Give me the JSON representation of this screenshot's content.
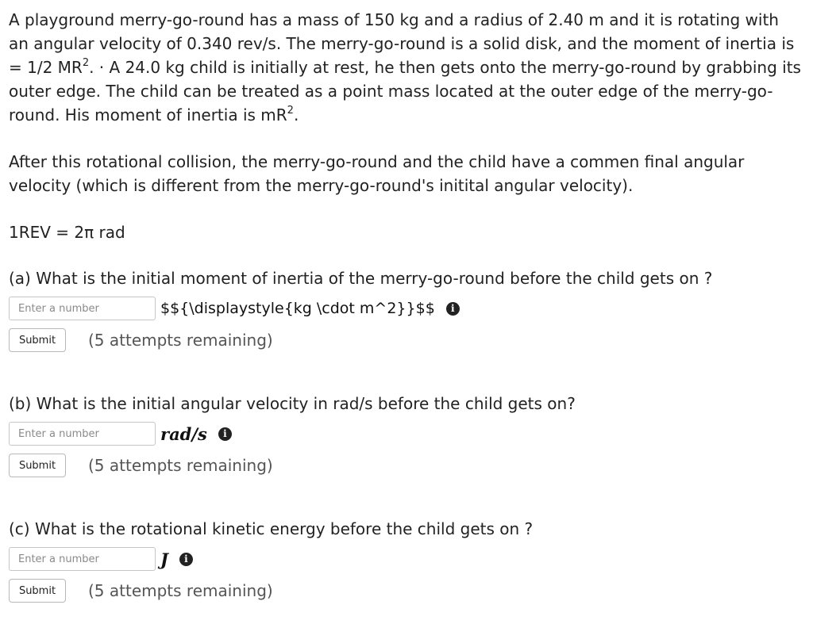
{
  "problem": {
    "p1_a": "A playground merry-go-round has a mass of 150 kg and a radius of 2.40 m and it is rotating with an angular velocity of 0.340 rev/s.   The merry-go-round is a solid disk, and the moment of inertia is = 1/2 MR",
    "p1_sup1": "2",
    "p1_b": ". · A 24.0 kg child is initially at rest, he then gets onto the merry-go-round by grabbing its outer edge. The child can be treated as a point mass located at the outer edge of the merry-go-round. His moment  of inertia is mR",
    "p1_sup2": "2",
    "p1_c": ".",
    "p2": "After this rotational collision, the merry-go-round and the child have a commen final angular velocity (which is different from the merry-go-round's initital angular velocity).",
    "p3": "1REV = 2π  rad"
  },
  "questions": [
    {
      "text": "(a) What is the initial moment of inertia of the merry-go-round before the child gets on ?",
      "placeholder": "Enter a number",
      "value": "",
      "unit": "$${\\displaystyle{kg \\cdot m^2}}$$",
      "info": "i",
      "submit": "Submit",
      "attempts": "(5 attempts remaining)"
    },
    {
      "text": "(b) What is the initial angular velocity in rad/s before the child gets on?",
      "placeholder": "Enter a number",
      "value": "",
      "unit": "rad/s",
      "info": "i",
      "submit": "Submit",
      "attempts": "(5 attempts remaining)"
    },
    {
      "text": "(c) What is the rotational kinetic energy before the child gets on ?",
      "placeholder": "Enter a number",
      "value": "",
      "unit": "J",
      "info": "i",
      "submit": "Submit",
      "attempts": "(5 attempts remaining)"
    }
  ]
}
